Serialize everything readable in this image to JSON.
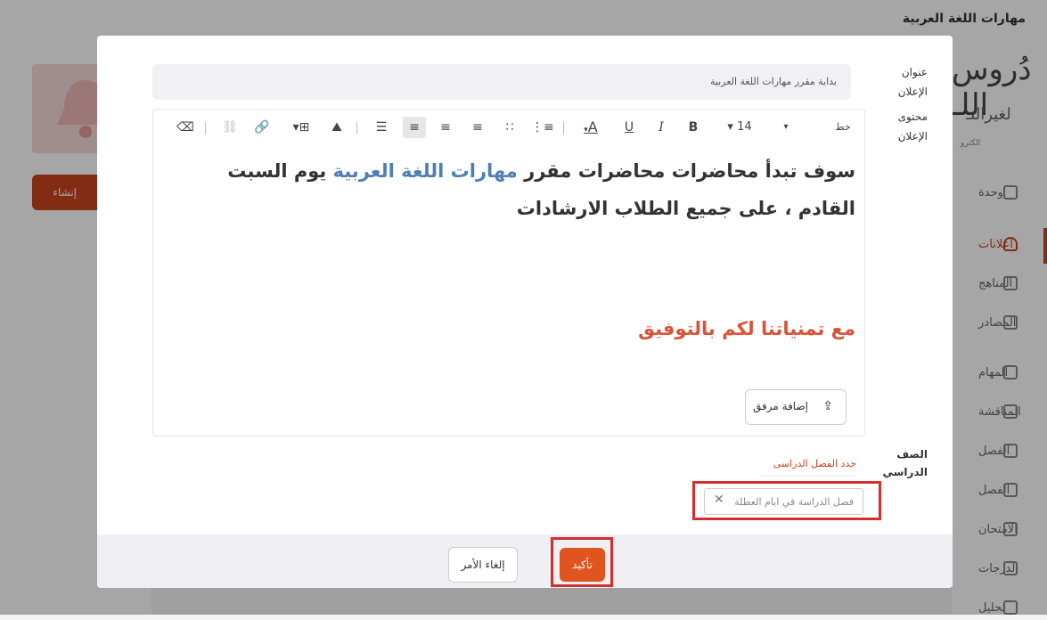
{
  "app": {
    "course_title": "مهارات اللغة العربية",
    "brand_line1": "دُروس اللـ",
    "brand_line2": "لغيرالنـ",
    "brand_line3": "الكترو",
    "create_button": "إنشاء إعلان"
  },
  "sidebar": {
    "items": [
      {
        "label": "وحدة"
      },
      {
        "label": "اعلانات"
      },
      {
        "label": "المناهج"
      },
      {
        "label": "المصادر"
      },
      {
        "label": "المهام"
      },
      {
        "label": "المناقشة"
      },
      {
        "label": "الفصل"
      },
      {
        "label": "الفصل"
      },
      {
        "label": "الامتحان"
      },
      {
        "label": "الدرجات"
      },
      {
        "label": "تحليل"
      }
    ]
  },
  "modal": {
    "title_label": "عنوان الإعلان",
    "title_value": "بداية مقرر مهارات اللغة العربية",
    "content_label": "محتوى الإعلان",
    "toolbar": {
      "font_label": "خط",
      "font_size": "14",
      "bold": "B",
      "italic": "I",
      "underline": "U",
      "color": "A"
    },
    "editor": {
      "line1_part1": "سوف تبدأ محاضرات محاضرات مقرر ",
      "line1_highlight": "مهارات اللغة العربية",
      "line1_part2": " يوم السبت القادم ، على جميع الطلاب الارشادات",
      "line3": "مع تمنياتنا لكم بالتوفيق",
      "highlight_color": "#4f7fb3",
      "closing_color": "#d9533a"
    },
    "attach_button": "إضافة مرفق",
    "class_label": "الصف الدراسي",
    "class_hint": "حدد الفصل الدراسى",
    "selected_class": "فصل الدراسة في ايام العطلة",
    "cancel_button": "إلغاء الأمر",
    "confirm_button": "تأكيد",
    "accent_color": "#e0541f"
  }
}
